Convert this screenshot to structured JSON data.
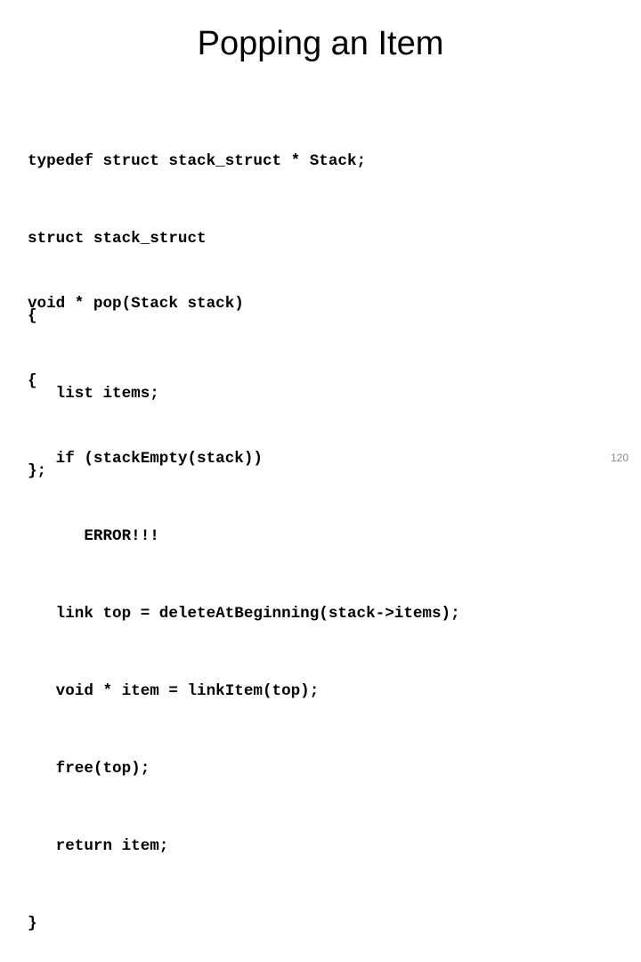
{
  "slide": {
    "title": "Popping an Item",
    "slide_number": "120",
    "code_block_1": [
      "typedef struct stack_struct * Stack;",
      "struct stack_struct",
      "{",
      "   list items;",
      "};"
    ],
    "code_block_2": [
      "void * pop(Stack stack)",
      "{",
      "   if (stackEmpty(stack))",
      "      ERROR!!!",
      "   link top = deleteAtBeginning(stack->items);",
      "   void * item = linkItem(top);",
      "   free(top);",
      "   return item;",
      "}"
    ]
  }
}
